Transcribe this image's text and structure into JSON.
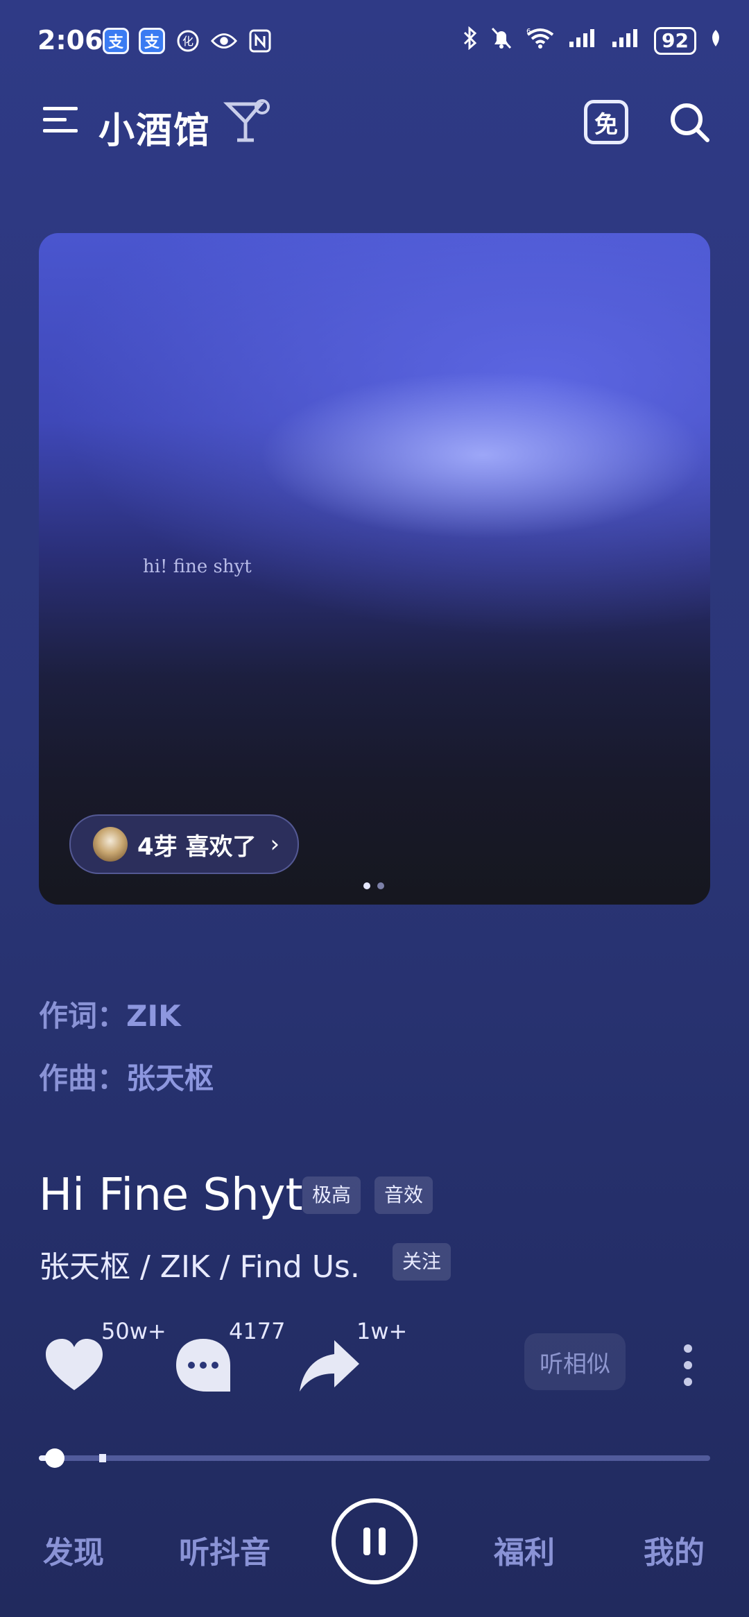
{
  "status_bar": {
    "time": "2:06",
    "left_icons": [
      "alipay-icon",
      "alipay-icon",
      "app-icon",
      "eye-icon",
      "nfc-icon"
    ],
    "battery": "92",
    "signal_label": "6"
  },
  "header": {
    "title": "小酒馆",
    "free_label": "免"
  },
  "cover": {
    "text": "hi! fine shyt",
    "likes_text": "4芽 喜欢了",
    "pages": 2,
    "active_page": 1
  },
  "credits": {
    "lyricist_label": "作词：",
    "lyricist": "ZIK",
    "composer_label": "作曲：",
    "composer": "张天枢"
  },
  "song": {
    "title": "Hi Fine Shyt",
    "tag_quality": "极高",
    "tag_effect": "音效",
    "artists": "张天枢 / ZIK / Find Us.",
    "follow_label": "关注"
  },
  "actions": {
    "like_count": "50w+",
    "comment_count": "4177",
    "share_count": "1w+",
    "similar_label": "听相似"
  },
  "progress": {
    "position_fraction": 0.02,
    "buffered_fraction": 0.09
  },
  "nav": {
    "discover": "发现",
    "douyin": "听抖音",
    "welfare": "福利",
    "mine": "我的"
  },
  "colors": {
    "accent_text": "#8a93d6",
    "background": "#2b3678"
  }
}
